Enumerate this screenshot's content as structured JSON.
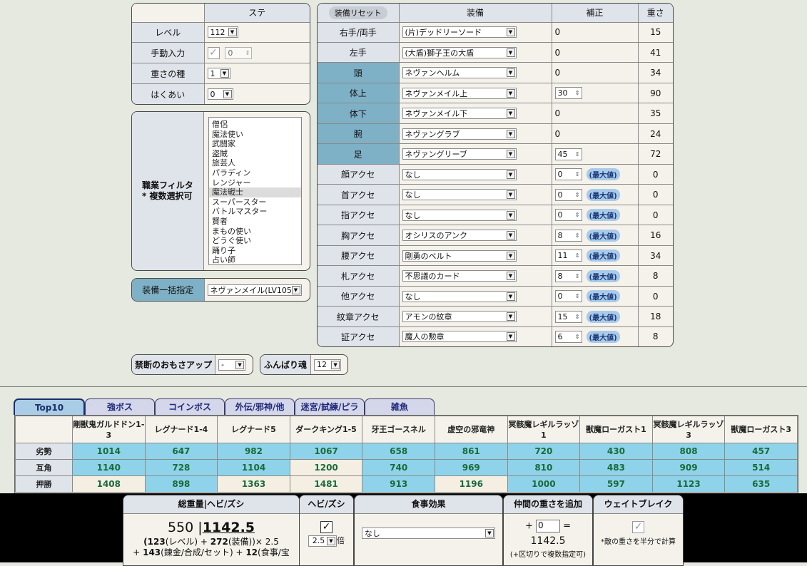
{
  "stats": {
    "header": "ステ",
    "rows": [
      {
        "label": "レベル",
        "value": "112"
      },
      {
        "label": "手動入力",
        "value": "0"
      },
      {
        "label": "重さの種",
        "value": "1"
      },
      {
        "label": "はくあい",
        "value": "0"
      }
    ]
  },
  "job_filter": {
    "label_line1": "職業フィルタ",
    "label_line2": "* 複数選択可",
    "items": [
      "僧侶",
      "魔法使い",
      "武闘家",
      "盗賊",
      "旅芸人",
      "パラディン",
      "レンジャー",
      "魔法戦士",
      "スーパースター",
      "バトルマスター",
      "賢者",
      "まもの使い",
      "どうぐ使い",
      "踊り子",
      "占い師"
    ],
    "selected": "魔法戦士"
  },
  "bulk_equip": {
    "label": "装備一括指定",
    "value": "ネヴァンメイル(LV105)"
  },
  "equip": {
    "reset_label": "装備リセット",
    "col_equip": "装備",
    "col_bonus": "補正",
    "col_weight": "重さ",
    "max_label": "(最大値)",
    "rows": [
      {
        "slot": "右手/両手",
        "item": "(片)デッドリーソード",
        "bonus": "0",
        "weight": "15"
      },
      {
        "slot": "左手",
        "item": "(大盾)獅子王の大盾",
        "bonus": "0",
        "weight": "41"
      },
      {
        "slot": "頭",
        "item": "ネヴァンヘルム",
        "bonus": "0",
        "weight": "34"
      },
      {
        "slot": "体上",
        "item": "ネヴァンメイル上",
        "bonus": "30",
        "weight": "90"
      },
      {
        "slot": "体下",
        "item": "ネヴァンメイル下",
        "bonus": "0",
        "weight": "35"
      },
      {
        "slot": "腕",
        "item": "ネヴァングラブ",
        "bonus": "0",
        "weight": "24"
      },
      {
        "slot": "足",
        "item": "ネヴァングリーブ",
        "bonus": "45",
        "weight": "72"
      },
      {
        "slot": "顔アクセ",
        "item": "なし",
        "bonus": "0",
        "weight": "0"
      },
      {
        "slot": "首アクセ",
        "item": "なし",
        "bonus": "0",
        "weight": "0"
      },
      {
        "slot": "指アクセ",
        "item": "なし",
        "bonus": "0",
        "weight": "0"
      },
      {
        "slot": "胸アクセ",
        "item": "オシリスのアンク",
        "bonus": "8",
        "weight": "16"
      },
      {
        "slot": "腰アクセ",
        "item": "剛勇のベルト",
        "bonus": "11",
        "weight": "34"
      },
      {
        "slot": "札アクセ",
        "item": "不思議のカード",
        "bonus": "8",
        "weight": "8"
      },
      {
        "slot": "他アクセ",
        "item": "なし",
        "bonus": "0",
        "weight": "0"
      },
      {
        "slot": "紋章アクセ",
        "item": "アモンの紋章",
        "bonus": "15",
        "weight": "18"
      },
      {
        "slot": "証アクセ",
        "item": "魔人の勲章",
        "bonus": "6",
        "weight": "8"
      }
    ]
  },
  "forbidden": {
    "label": "禁断のおもさアップ",
    "value": "-"
  },
  "funbari": {
    "label": "ふんばり魂",
    "value": "12"
  },
  "tabs": [
    "Top10",
    "強ボス",
    "コインボス",
    "外伝/邪神/他",
    "迷宮/試練/ピラ",
    "雑魚"
  ],
  "monsters": {
    "columns": [
      "剛獣鬼ガルドドン1-3",
      "レグナード1-4",
      "レグナード5",
      "ダークキング1-5",
      "牙王ゴースネル",
      "虚空の邪竜神",
      "冥骸魔レギルラッゾ1",
      "獣魔ローガスト1",
      "冥骸魔レギルラッゾ3",
      "獣魔ローガスト3"
    ],
    "rows": [
      {
        "label": "劣勢",
        "values": [
          "1014",
          "647",
          "982",
          "1067",
          "658",
          "861",
          "720",
          "430",
          "808",
          "457"
        ],
        "cells": [
          "b",
          "b",
          "b",
          "b",
          "b",
          "b",
          "b",
          "b",
          "b",
          "b"
        ]
      },
      {
        "label": "互角",
        "values": [
          "1140",
          "728",
          "1104",
          "1200",
          "740",
          "969",
          "810",
          "483",
          "909",
          "514"
        ],
        "cells": [
          "b",
          "b",
          "b",
          "w",
          "b",
          "b",
          "b",
          "b",
          "b",
          "b"
        ]
      },
      {
        "label": "押勝",
        "values": [
          "1408",
          "898",
          "1363",
          "1481",
          "913",
          "1196",
          "1000",
          "597",
          "1123",
          "635"
        ],
        "cells": [
          "w",
          "b",
          "w",
          "w",
          "b",
          "w",
          "b",
          "b",
          "b",
          "b"
        ]
      }
    ]
  },
  "summary": {
    "total_header": "総重量|ヘビ/ズシ",
    "base_total": "550 |",
    "total": "1142.5",
    "formula_line1_a": "(123",
    "formula_line1_b": "(レベル) + ",
    "formula_line1_c": "272",
    "formula_line1_d": "(装備))× 2.5",
    "formula_line2_a": "+ ",
    "formula_line2_b": "143",
    "formula_line2_c": "(錬金/合成/セット) + ",
    "formula_line2_d": "12",
    "formula_line2_e": "(食事/宝",
    "hebi_header": "ヘビ/ズシ",
    "multiplier": "2.5",
    "multiplier_suffix": "倍",
    "food_header": "食事効果",
    "food_value": "なし",
    "ally_header": "仲間の重さを追加",
    "ally_plus": "+",
    "ally_value": "0",
    "ally_eq": "=",
    "ally_result": "1142.5",
    "ally_note": "(+区切りで複数指定可)",
    "weight_break_header": "ウェイトブレイク",
    "weight_break_note": "*敵の重さを半分で計算"
  }
}
